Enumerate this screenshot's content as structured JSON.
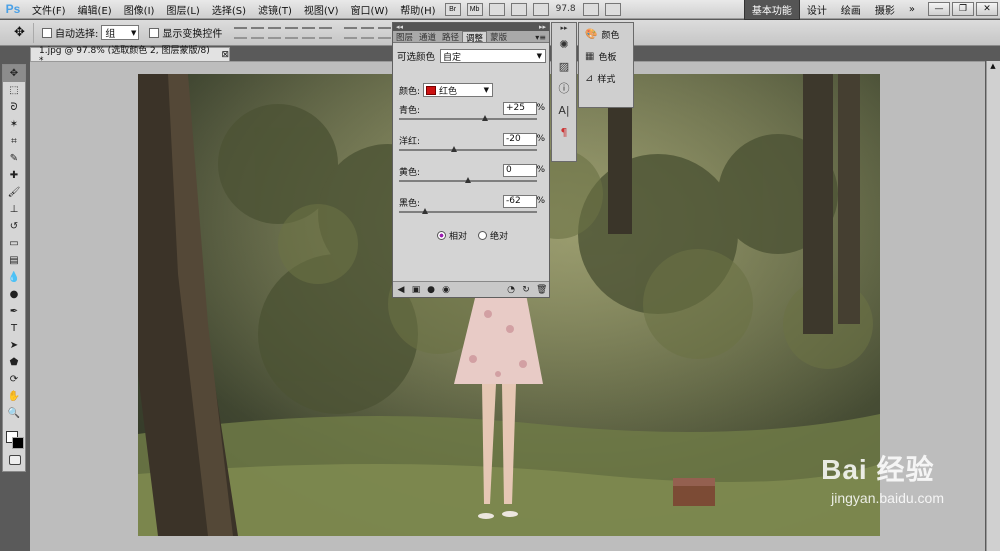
{
  "app": {
    "logo": "Ps",
    "menu": [
      "文件(F)",
      "编辑(E)",
      "图像(I)",
      "图层(L)",
      "选择(S)",
      "滤镜(T)",
      "视图(V)",
      "窗口(W)",
      "帮助(H)"
    ],
    "bridge_icon": "Br",
    "minibridge_icon": "Mb",
    "zoom": "97.8",
    "workspaces": [
      "基本功能",
      "设计",
      "绘画",
      "摄影"
    ],
    "workspace_more": "»",
    "window_controls": [
      "—",
      "❐",
      "✕"
    ]
  },
  "options_bar": {
    "auto_select_label": "自动选择:",
    "auto_select_value": "组",
    "show_transform_label": "显示变换控件"
  },
  "document": {
    "tab_title": "1.jpg @ 97.8% (选取颜色 2, 图层蒙版/8) *",
    "tab_close": "⊠"
  },
  "panel": {
    "tabs": [
      "图层",
      "通道",
      "路径",
      "调整",
      "蒙版"
    ],
    "active_tab": "调整",
    "title": "可选颜色",
    "preset": "自定",
    "color_label": "颜色:",
    "color_value": "红色",
    "color_chip": "#cc1111",
    "sliders": [
      {
        "label": "青色:",
        "value": "+25",
        "unit": "%",
        "fraction": 0.625
      },
      {
        "label": "洋红:",
        "value": "-20",
        "unit": "%",
        "fraction": 0.4
      },
      {
        "label": "黄色:",
        "value": "0",
        "unit": "%",
        "fraction": 0.5
      },
      {
        "label": "黑色:",
        "value": "-62",
        "unit": "%",
        "fraction": 0.19
      }
    ],
    "mode_relative": "相对",
    "mode_absolute": "绝对"
  },
  "float_panel": {
    "items": [
      "颜色",
      "色板",
      "样式"
    ]
  },
  "watermark": {
    "main": "Bai 经验",
    "sub": "jingyan.baidu.com"
  }
}
